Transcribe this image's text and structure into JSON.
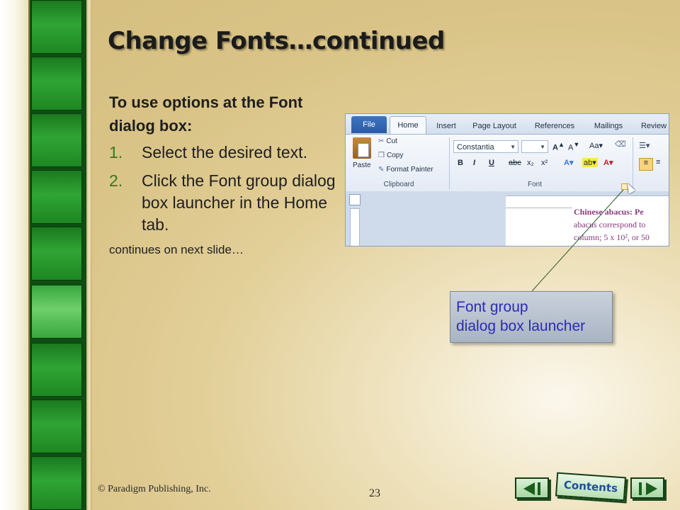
{
  "slide": {
    "title": "Change Fonts…continued",
    "intro": "To use options at the Font dialog box:",
    "steps": [
      {
        "num": "1.",
        "text": "Select the desired text."
      },
      {
        "num": "2.",
        "text": "Click the Font group dialog box launcher in the Home tab."
      }
    ],
    "continues": "continues on next slide…",
    "callout": {
      "line1": "Font group",
      "line2": "dialog box launcher"
    },
    "copyright": "© Paradigm Publishing, Inc.",
    "page_number": "23",
    "nav": {
      "contents": "Contents",
      "prev_icon": "triangle-left-icon",
      "next_icon": "triangle-right-icon"
    }
  },
  "word_screenshot": {
    "tabs": [
      "File",
      "Home",
      "Insert",
      "Page Layout",
      "References",
      "Mailings",
      "Review"
    ],
    "clipboard": {
      "paste": "Paste",
      "cut": "Cut",
      "copy": "Copy",
      "format_painter": "Format Painter",
      "group_label": "Clipboard"
    },
    "font": {
      "font_name": "Constantia",
      "font_size": "",
      "group_label": "Font",
      "buttons": [
        "B",
        "I",
        "U",
        "abc",
        "x₂",
        "x²"
      ]
    },
    "document_lines": [
      "Chinese abacus: Pe",
      "abacus correspond to",
      "column; 5 x 10², or 50"
    ]
  },
  "colors": {
    "accent_green": "#2f7a24",
    "callout_text": "#2b2bb6",
    "strip_green": "#1e8722"
  }
}
